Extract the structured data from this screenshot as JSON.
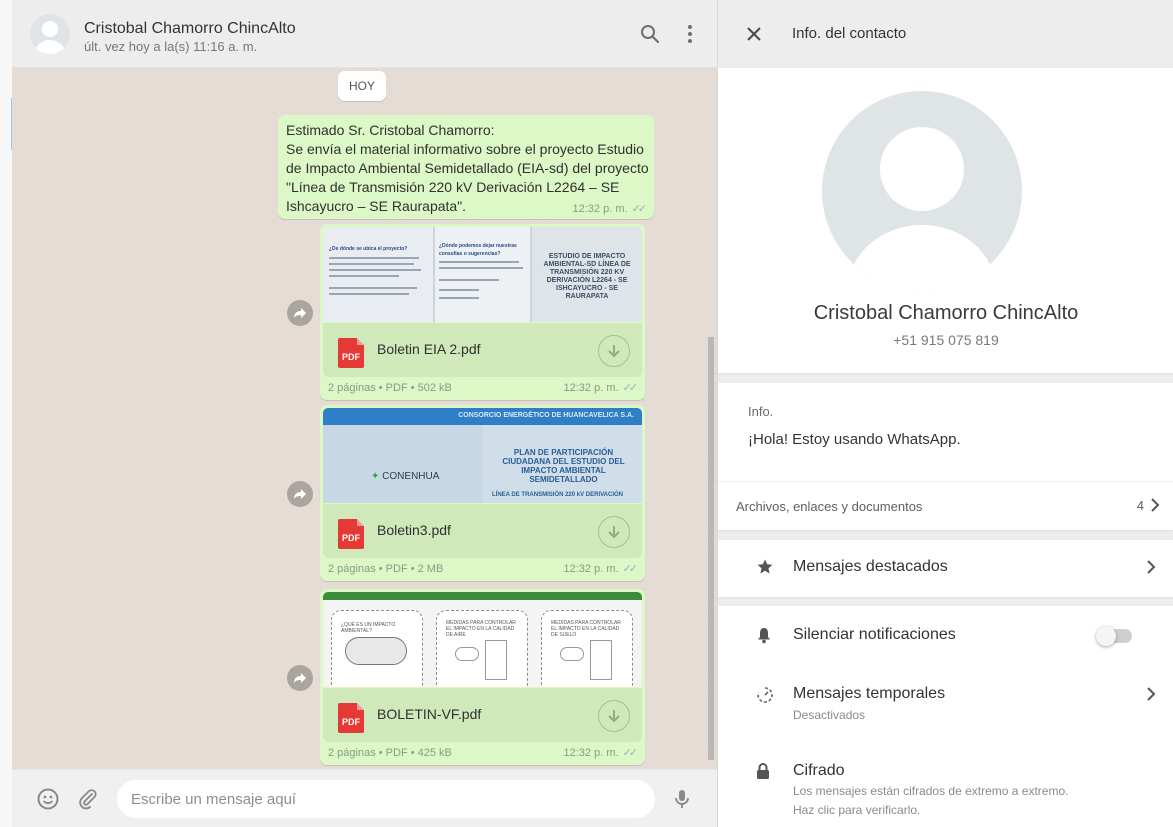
{
  "chat": {
    "contact_name": "Cristobal Chamorro ChincAlto",
    "last_seen": "últ. vez hoy a la(s) 11:16 a. m.",
    "search_icon": "search-icon",
    "menu_icon": "more-vertical-icon",
    "date_divider": "HOY",
    "text_message": {
      "text": "Estimado Sr. Cristobal Chamorro:\nSe envía el material informativo sobre el proyecto Estudio de Impacto Ambiental Semidetallado (EIA-sd) del proyecto \"Línea de Transmisión 220 kV Derivación L2264 – SE Ishcayucro – SE Raurapata\".",
      "time": "12:32 p. m.",
      "status": "read"
    },
    "documents": [
      {
        "file_name": "Boletin EIA 2.pdf",
        "meta": "2 páginas • PDF • 502 kB",
        "time": "12:32 p. m.",
        "preview_title": "ESTUDIO DE IMPACTO AMBIENTAL-SD LÍNEA DE TRANSMISIÓN 220 KV DERIVACIÓN L2264 - SE ISHCAYUCRO - SE RAURAPATA",
        "preview_heading_left": "¿De dónde se ubica el proyecto?",
        "preview_heading_mid": "¿Dónde podemos dejar nuestras consultas o sugerencias?"
      },
      {
        "file_name": "Boletin3.pdf",
        "meta": "2 páginas • PDF • 2 MB",
        "time": "12:32 p. m.",
        "preview_band": "CONSORCIO ENERGÉTICO DE HUANCAVELICA S.A.",
        "preview_title": "PLAN DE PARTICIPACIÓN CIUDADANA DEL ESTUDIO DEL IMPACTO AMBIENTAL SEMIDETALLADO",
        "preview_logo": "CONENHUA",
        "preview_sub": "LÍNEA DE TRANSMISIÓN 220 kV DERIVACIÓN"
      },
      {
        "file_name": "BOLETIN-VF.pdf",
        "meta": "2 páginas • PDF • 425 kB",
        "time": "12:32 p. m.",
        "preview_col1": "¿QUÉ ES UN IMPACTO AMBIENTAL?",
        "preview_col2": "MEDIDAS PARA CONTROLAR EL IMPACTO EN LA CALIDAD DE AIRE",
        "preview_col3": "MEDIDAS PARA CONTROLAR EL IMPACTO EN LA CALIDAD DE SUELO"
      }
    ],
    "composer": {
      "emoji_icon": "emoji-icon",
      "attach_icon": "paperclip-icon",
      "placeholder": "Escribe un mensaje aquí",
      "mic_icon": "microphone-icon"
    }
  },
  "info": {
    "header_title": "Info. del contacto",
    "name": "Cristobal Chamorro ChincAlto",
    "phone": "+51 915 075 819",
    "about_label": "Info.",
    "about_text": "¡Hola! Estoy usando WhatsApp.",
    "media_label": "Archivos, enlaces y documentos",
    "media_count": "4",
    "starred_label": "Mensajes destacados",
    "mute_label": "Silenciar notificaciones",
    "mute_enabled": false,
    "disappearing_label": "Mensajes temporales",
    "disappearing_value": "Desactivados",
    "encryption_label": "Cifrado",
    "encryption_desc_1": "Los mensajes están cifrados de extremo a extremo.",
    "encryption_desc_2": "Haz clic para verificarlo."
  },
  "colors": {
    "outgoing_bubble": "#dcf8c6",
    "chat_background": "#e5ddd5",
    "panel_header": "#ededed",
    "read_tick": "#8ab4c6",
    "pdf_red": "#e53935"
  }
}
